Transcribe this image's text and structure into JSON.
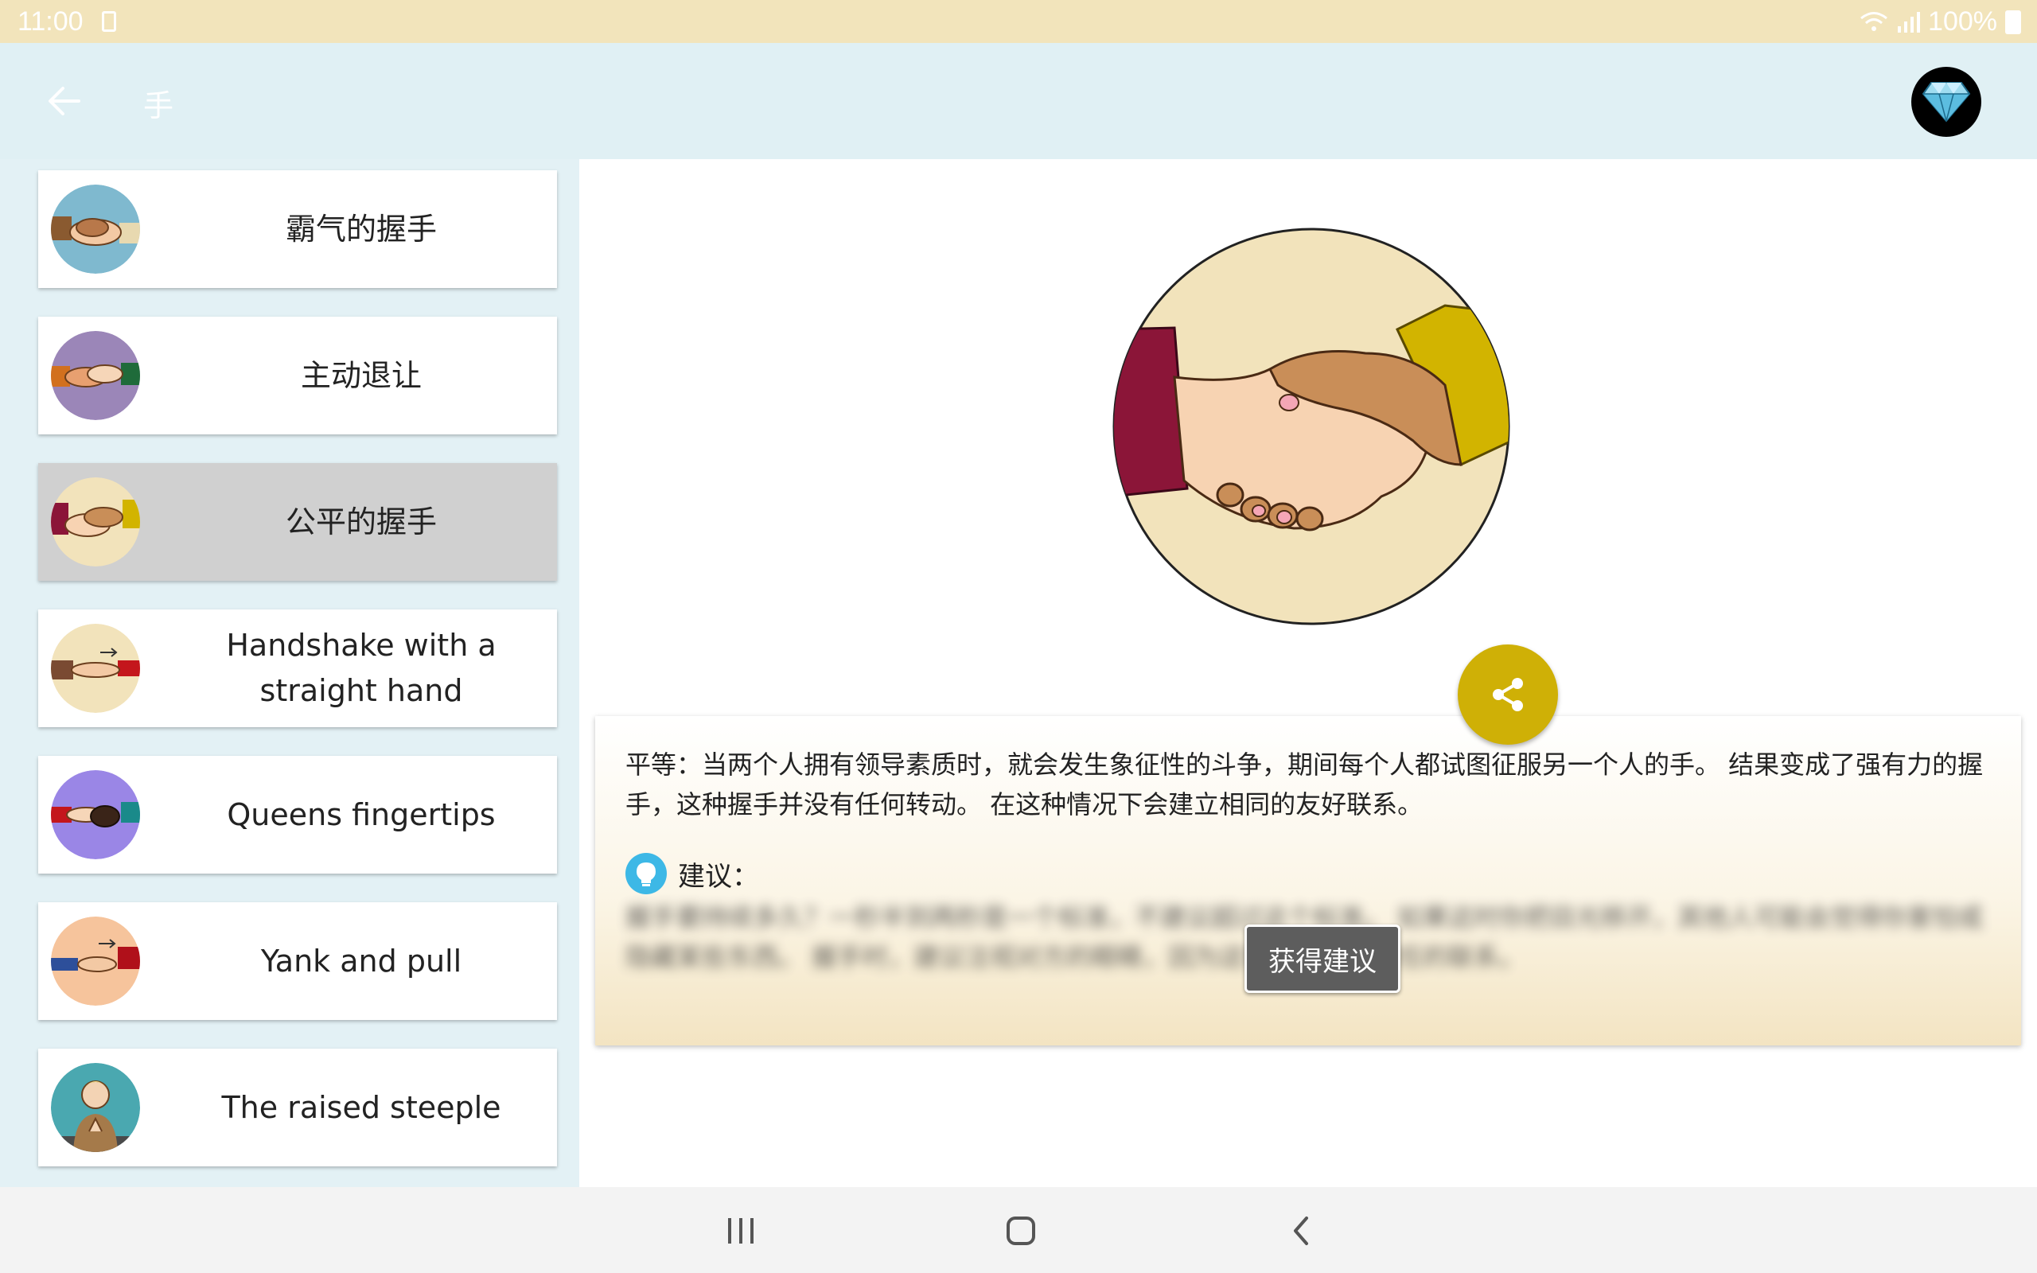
{
  "status_bar": {
    "time": "11:00",
    "battery_percent": "100%"
  },
  "app_bar": {
    "title": "手"
  },
  "sidebar": {
    "items": [
      {
        "label": "霸气的握手",
        "selected": false,
        "thumb_bg": "#7fb9cf"
      },
      {
        "label": "主动退让",
        "selected": false,
        "thumb_bg": "#9b86b8"
      },
      {
        "label": "公平的握手",
        "selected": true,
        "thumb_bg": "#f2e3bb"
      },
      {
        "label": "Handshake with a straight hand",
        "selected": false,
        "thumb_bg": "#f2e3bb"
      },
      {
        "label": "Queens fingertips",
        "selected": false,
        "thumb_bg": "#9a86e6"
      },
      {
        "label": "Yank and pull",
        "selected": false,
        "thumb_bg": "#f6c49c"
      },
      {
        "label": "The raised steeple",
        "selected": false,
        "thumb_bg": "#4aa8b0"
      }
    ]
  },
  "detail": {
    "description": "平等：当两个人拥有领导素质时，就会发生象征性的斗争，期间每个人都试图征服另一个人的手。 结果变成了强有力的握手，这种握手并没有任何转动。 在这种情况下会建立相同的友好联系。",
    "advice_label": "建议：",
    "advice_blurred": "握手要持续多久？一秒半到两秒是一个标准，不建议超过这个标准。 如果这时你把目光移开，其他人可能会觉得你害怕或隐藏某些东西。 握手时，建议注视对方的眼睛，因为这有助于建立信任的联系。",
    "get_advice_button": "获得建议"
  },
  "colors": {
    "status_bar_bg": "#f2e4bb",
    "app_bar_bg": "#e0f0f4",
    "share_button": "#cfb006",
    "selected_item": "#d0d0d0"
  },
  "icons": {
    "back": "arrow-left-icon",
    "premium": "diamond-icon",
    "share": "share-icon",
    "advice": "lightbulb-icon",
    "nav_recent": "recent-apps-icon",
    "nav_home": "home-icon",
    "nav_back": "back-chevron-icon"
  }
}
